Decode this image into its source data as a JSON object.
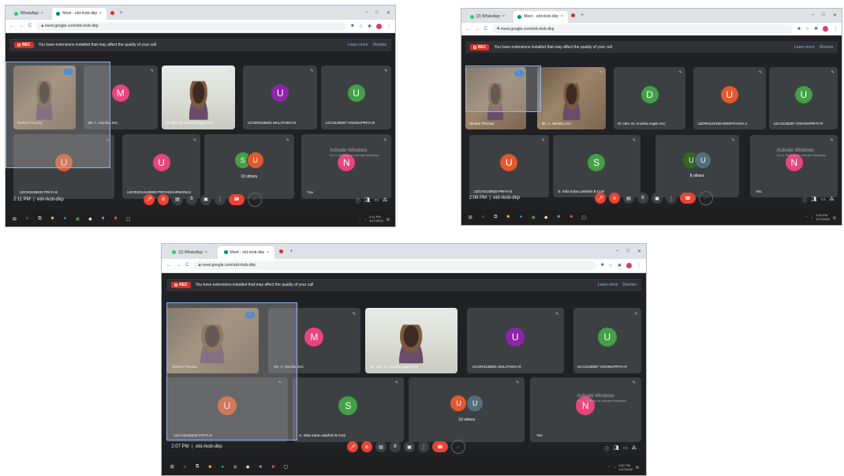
{
  "shots": [
    {
      "tabs": [
        "WhatsApp",
        "Meet - etd-rkob-dkp"
      ],
      "url": "meet.google.com/etd-rkob-dkp",
      "banner": {
        "rec": "REC",
        "message": "You have extensions installed that may affect the quality of your call",
        "learn": "Learn more",
        "dismiss": "Dismiss"
      },
      "tiles": [
        {
          "name": "shelma Thomas",
          "video": "dark",
          "speaking": true
        },
        {
          "name": "Ms. A. Monika JAC",
          "initial": "M",
          "color": "#e8457b"
        },
        {
          "name": "Dr. Mrs. M. Anusha Angel JAC",
          "video": "light"
        },
        {
          "name": "UCOR3146801 MALATHIKA R",
          "initial": "U",
          "color": "#8e24aa"
        },
        {
          "name": "UCA3139397 VISHNUPRIYA R",
          "initial": "U",
          "color": "#43a047"
        },
        {
          "name": "UZCH3135833 PRIYA B",
          "initial": "U",
          "color": "#e2592d"
        },
        {
          "name": "UZOR2014140902 PRIYADHARSHINI K",
          "initial": "U",
          "color": "#e8457b"
        },
        {
          "name": "",
          "others": "10 others",
          "initials": [
            "S",
            "U"
          ],
          "colors": [
            "#43a047",
            "#e2592d"
          ]
        },
        {
          "name": "You",
          "initial": "N",
          "color": "#e8457b"
        }
      ],
      "clock": "2:11 PM",
      "code": "etd-rkob-dkp",
      "activate": "Activate Windows",
      "activate_sub": "Go to Settings to activate Windows.",
      "taskbar_time": "2:11 PM",
      "taskbar_date": "1/17/2022"
    },
    {
      "tabs": [
        "(2) WhatsApp",
        "Meet - etd-rkob-dkp"
      ],
      "url": "meet.google.com/etd-rkob-dkp",
      "banner": {
        "rec": "REC",
        "message": "You have extensions installed that may affect the quality of your call",
        "learn": "Learn more",
        "dismiss": "Dismiss"
      },
      "tiles": [
        {
          "name": "shelma Thomas",
          "video": "dark",
          "speaking": true
        },
        {
          "name": "Ms. A. Monika JAC",
          "video": "dark"
        },
        {
          "name": "Dr. Mrs. M. Anusha Angel JAC",
          "initial": "D",
          "color": "#43a047"
        },
        {
          "name": "UZOR3144165 KEERTHANA A",
          "initial": "U",
          "color": "#e2592d"
        },
        {
          "name": "UCA3139397 VISHNUPRIYA R",
          "initial": "U",
          "color": "#43a047"
        },
        {
          "name": "UZCH3135833 PRIYA B",
          "initial": "U",
          "color": "#e2592d"
        },
        {
          "name": "S. Inba Suba Lakshmi B.Com",
          "initial": "S",
          "color": "#43a047"
        },
        {
          "name": "",
          "others": "8 others",
          "initials": [
            "U",
            "U"
          ],
          "colors": [
            "#33691e",
            "#546e7a"
          ]
        },
        {
          "name": "You",
          "initial": "N",
          "color": "#e8457b"
        }
      ],
      "clock": "2:06 PM",
      "code": "etd-rkob-dkp",
      "activate": "Activate Windows",
      "activate_sub": "Go to Settings to activate Windows.",
      "taskbar_time": "2:06 PM",
      "taskbar_date": "1/17/2022"
    },
    {
      "tabs": [
        "(2) WhatsApp",
        "Meet - etd-rkob-dkp"
      ],
      "url": "meet.google.com/etd-rkob-dkp",
      "banner": {
        "rec": "REC",
        "message": "You have extensions installed that may affect the quality of your call",
        "learn": "Learn more",
        "dismiss": "Dismiss"
      },
      "tiles": [
        {
          "name": "shelma Thomas",
          "video": "dark",
          "speaking": true
        },
        {
          "name": "Ms. A. Monika JAC",
          "initial": "M",
          "color": "#e8457b"
        },
        {
          "name": "Dr. Mrs. M. Anusha Angel JAC",
          "video": "light"
        },
        {
          "name": "UCOR3146801 MALATHIKA R",
          "initial": "U",
          "color": "#8e24aa"
        },
        {
          "name": "UCA3139397 VISHNUPRIYA R",
          "initial": "U",
          "color": "#43a047"
        },
        {
          "name": "UZCH3135833 PRIYA B",
          "initial": "U",
          "color": "#e2592d"
        },
        {
          "name": "S. Inba Suba Lakshmi B.Com",
          "initial": "S",
          "color": "#43a047"
        },
        {
          "name": "",
          "others": "10 others",
          "initials": [
            "U",
            "U"
          ],
          "colors": [
            "#e2592d",
            "#546e7a"
          ]
        },
        {
          "name": "You",
          "initial": "N",
          "color": "#e8457b"
        }
      ],
      "clock": "2:07 PM",
      "code": "etd-rkob-dkp",
      "activate": "Activate Windows",
      "activate_sub": "Go to Settings to activate Windows.",
      "taskbar_time": "2:07 PM",
      "taskbar_date": "1/17/2022"
    }
  ],
  "icons": {
    "mic_off": "mic-off-icon",
    "cam_off": "camera-off-icon",
    "captions": "captions-icon",
    "hand": "raise-hand-icon",
    "present": "present-icon",
    "more": "more-options-icon",
    "end_call": "end-call-icon",
    "info": "info-icon",
    "people": "people-icon",
    "chat": "chat-icon",
    "activities": "activities-icon"
  },
  "colors": {
    "meet_bg": "#202124",
    "tile_bg": "#3c4043",
    "rec_red": "#d93025",
    "accent_blue": "#8ab4f8"
  }
}
